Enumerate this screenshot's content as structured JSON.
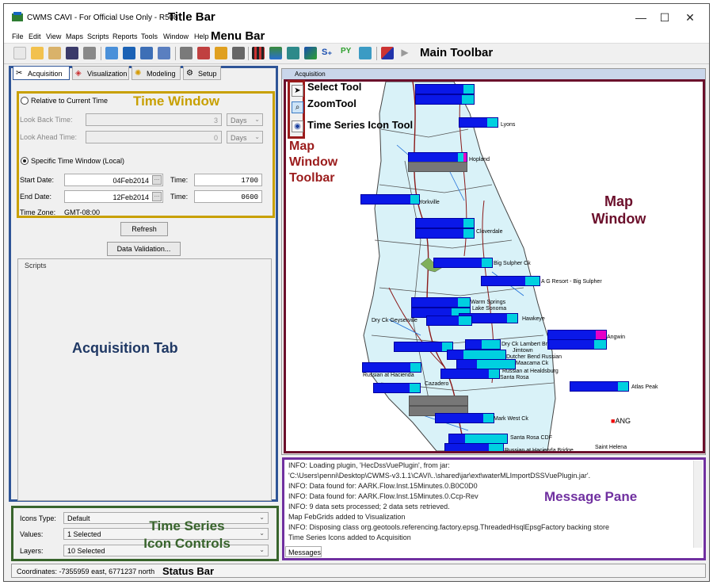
{
  "title_bar": {
    "app_title": "CWMS CAVI - For Official Use Only - R508",
    "callout": "Title Bar",
    "minimize": "—",
    "maximize": "☐",
    "close": "✕"
  },
  "menu_bar": {
    "items": [
      "File",
      "Edit",
      "View",
      "Maps",
      "Scripts",
      "Reports",
      "Tools",
      "Window",
      "Help"
    ],
    "callout": "Menu Bar"
  },
  "main_toolbar": {
    "callout": "Main Toolbar",
    "s_plus": "S₊",
    "py": "PY"
  },
  "tabs": [
    {
      "label": "Acquisition",
      "icon": "✂"
    },
    {
      "label": "Visualization",
      "icon": "◈"
    },
    {
      "label": "Modeling",
      "icon": "✺"
    },
    {
      "label": "Setup",
      "icon": "⚙"
    }
  ],
  "time_window": {
    "callout": "Time Window",
    "relative_label": "Relative to Current Time",
    "look_back_label": "Look Back Time:",
    "look_back_value": "3",
    "look_back_unit": "Days",
    "look_ahead_label": "Look Ahead Time:",
    "look_ahead_value": "0",
    "look_ahead_unit": "Days",
    "specific_label": "Specific Time Window (Local)",
    "start_date_label": "Start Date:",
    "start_date": "04Feb2014",
    "start_time_label": "Time:",
    "start_time": "1700",
    "end_date_label": "End Date:",
    "end_date": "12Feb2014",
    "end_time_label": "Time:",
    "end_time": "0600",
    "timezone_label": "Time Zone:",
    "timezone": "GMT-08:00",
    "selected": "specific",
    "calendar_glyph": "…"
  },
  "buttons": {
    "refresh": "Refresh",
    "data_validation": "Data Validation..."
  },
  "scripts": {
    "title": "Scripts",
    "callout": "Acquisition Tab"
  },
  "icon_controls": {
    "callout_line1": "Time Series",
    "callout_line2": "Icon Controls",
    "icons_type_label": "Icons Type:",
    "icons_type": "Default",
    "values_label": "Values:",
    "values": "1 Selected",
    "layers_label": "Layers:",
    "layers": "10 Selected"
  },
  "map": {
    "header": "Acquisition",
    "callout_line1": "Map",
    "callout_line2": "Window",
    "tools": {
      "select_icon": "➤",
      "zoom_icon": "⌕",
      "ts_icon": "◉",
      "select_callout": "Select Tool",
      "zoom_callout": "ZoomTool",
      "ts_callout": "Time Series Icon Tool",
      "toolbar_callout_1": "Map",
      "toolbar_callout_2": "Window",
      "toolbar_callout_3": "Toolbar"
    },
    "sites": [
      "Lyons",
      "Hopland",
      "Yorkville",
      "Cloverdale",
      "Big Sulpher Ck",
      "A G Resort - Big Sulpher",
      "Warm Springs",
      "Lake Sonoma",
      "Hawkeye",
      "Dry Ck Geyserville",
      "Angwin",
      "Dry Ck Lambert Br",
      "Jimtown",
      "Dutcher Bend Russian",
      "Maacama Ck",
      "Russian at Healdsburg",
      "Santa Rosa",
      "Cazadero",
      "Atlas Peak",
      "Mark West Ck",
      "Santa Rosa CDF",
      "Saint Helena",
      "ANG",
      "Russian at Hacienda Bridge",
      "Russian at Hacienda"
    ]
  },
  "messages": {
    "callout": "Message Pane",
    "tab": "Messages",
    "lines": [
      "INFO: Loading plugin, 'HecDssVuePlugin', from jar:",
      "'C:\\Users\\penni\\Desktop\\CWMS-v3.1.1\\CAVI\\..\\shared\\jar\\ext\\waterMLImportDSSVuePlugin.jar'.",
      "INFO: Data found for: AARK.Flow.Inst.15Minutes.0.B0C0D0",
      "INFO: Data found for: AARK.Flow.Inst.15Minutes.0.Ccp-Rev",
      "INFO: 9 data sets processed; 2 data sets retrieved.",
      "Map FebGrids added to Visualization",
      "INFO: Disposing class org.geotools.referencing.factory.epsg.ThreadedHsqlEpsgFactory backing store",
      "Time Series Icons added to Acquisition"
    ]
  },
  "status_bar": {
    "coordinates": "Coordinates: -7355959 east, 6771237 north",
    "callout": "Status Bar"
  },
  "colors": {
    "accent_blue": "#2f5597",
    "gold": "#c8a000",
    "map_red": "#9b1c1c",
    "maroon": "#6b0f2b",
    "purple": "#7030a0",
    "green": "#38642c",
    "icon_blue": "#0a18e8",
    "icon_cyan": "#00d0e0"
  }
}
